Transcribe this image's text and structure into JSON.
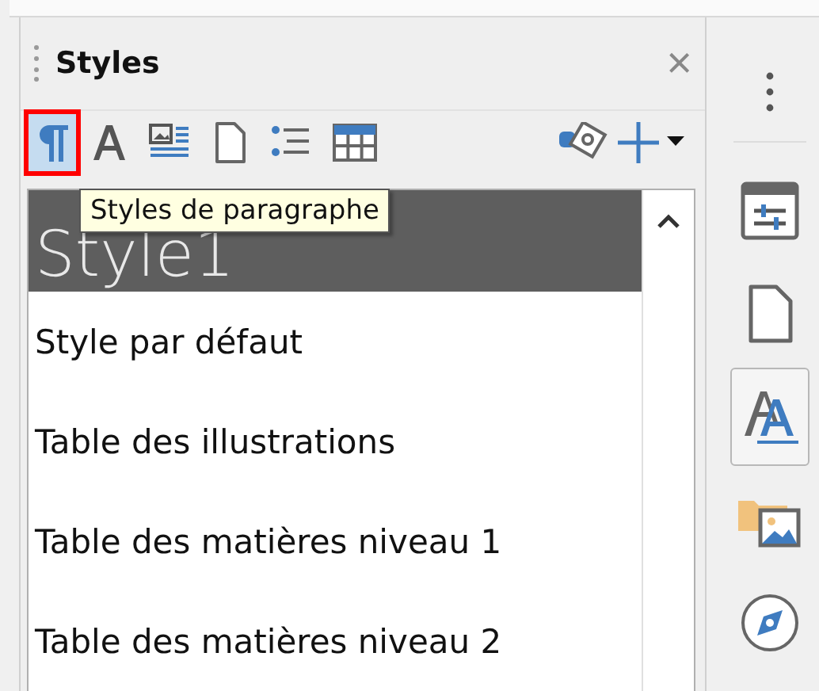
{
  "panel": {
    "title": "Styles",
    "close": "×"
  },
  "toolbar": [
    {
      "kind": "paragraph",
      "selected": true,
      "highlighted": true
    },
    {
      "kind": "character",
      "selected": false,
      "highlighted": false
    },
    {
      "kind": "frame",
      "selected": false,
      "highlighted": false
    },
    {
      "kind": "page",
      "selected": false,
      "highlighted": false
    },
    {
      "kind": "list",
      "selected": false,
      "highlighted": false
    },
    {
      "kind": "table",
      "selected": false,
      "highlighted": false
    }
  ],
  "tooltip": "Styles de paragraphe",
  "styles": [
    {
      "name": "Style1",
      "selected": true
    },
    {
      "name": "Style par défaut",
      "selected": false
    },
    {
      "name": "Table des illustrations",
      "selected": false
    },
    {
      "name": "Table des matières niveau 1",
      "selected": false
    },
    {
      "name": "Table des matières niveau 2",
      "selected": false
    }
  ],
  "sidebar": [
    {
      "kind": "properties",
      "selected": false
    },
    {
      "kind": "page",
      "selected": false
    },
    {
      "kind": "styles",
      "selected": true
    },
    {
      "kind": "gallery",
      "selected": false
    },
    {
      "kind": "navigator",
      "selected": false
    }
  ]
}
